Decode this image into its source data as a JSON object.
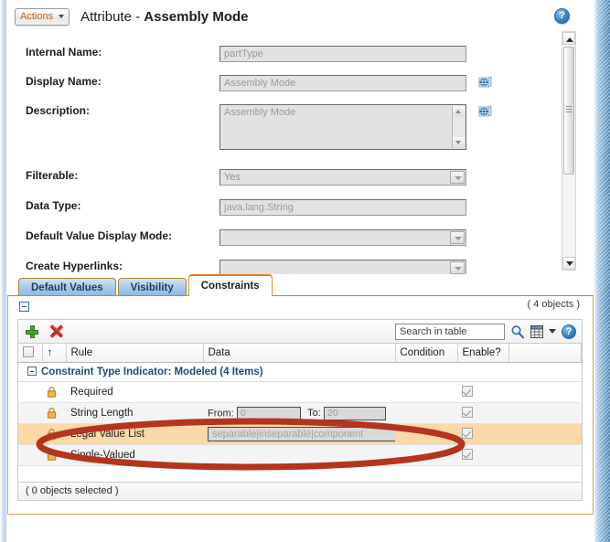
{
  "window": {
    "actions_button": "Actions",
    "title_prefix": "Attribute - ",
    "title_object": "Assembly Mode",
    "help_icon": "help-icon"
  },
  "form": {
    "fields": [
      {
        "label": "Internal Name:",
        "value": "partType",
        "type": "text"
      },
      {
        "label": "Display Name:",
        "value": "Assembly Mode",
        "type": "text",
        "globe": true
      },
      {
        "label": "Description:",
        "value": "Assembly Mode",
        "type": "textarea",
        "globe": true
      },
      {
        "label": "Filterable:",
        "value": "Yes",
        "type": "combo"
      },
      {
        "label": "Data Type:",
        "value": "java.lang.String",
        "type": "text"
      },
      {
        "label": "Default Value Display Mode:",
        "value": "",
        "type": "combo"
      },
      {
        "label": "Create Hyperlinks:",
        "value": "",
        "type": "combo"
      }
    ]
  },
  "tabs": [
    {
      "label": "Default Values",
      "active": false
    },
    {
      "label": "Visibility",
      "active": false
    },
    {
      "label": "Constraints",
      "active": true
    }
  ],
  "panel": {
    "object_count": "( 4 objects )",
    "toolbar": {
      "add_label": "add-row",
      "delete_label": "delete-row",
      "search_placeholder": "Search in table",
      "search_value": "",
      "table_options": "table-options",
      "help": "?"
    },
    "table": {
      "columns": [
        "",
        "↑",
        "Rule",
        "Data",
        "Condition",
        "Enable?",
        ""
      ],
      "group_row": "Constraint Type Indicator: Modeled (4 Items)",
      "rows": [
        {
          "rule": "Required",
          "data": "",
          "condition": "",
          "enabled": true,
          "selected": false
        },
        {
          "rule": "String Length",
          "data": "range",
          "from_label": "From:",
          "from_value": "0",
          "to_label": "To:",
          "to_value": "20",
          "condition": "",
          "enabled": true,
          "selected": false
        },
        {
          "rule": "Legal Value List",
          "data": "separable|inseparable|component",
          "condition": "",
          "enabled": true,
          "selected": true
        },
        {
          "rule": "Single-Valued",
          "data": "",
          "condition": "",
          "enabled": true,
          "selected": false
        }
      ]
    },
    "status": "( 0 objects selected )"
  },
  "annotation": {
    "shape": "ellipse-highlight",
    "color": "#b4341d",
    "target_row": "Legal Value List"
  },
  "colors": {
    "accent_orange": "#e07b18",
    "tab_blue": "#a9cbe8",
    "selected_row": "#fbd8a6",
    "annotation_red": "#b4341d",
    "link_blue": "#1b4d7a"
  }
}
